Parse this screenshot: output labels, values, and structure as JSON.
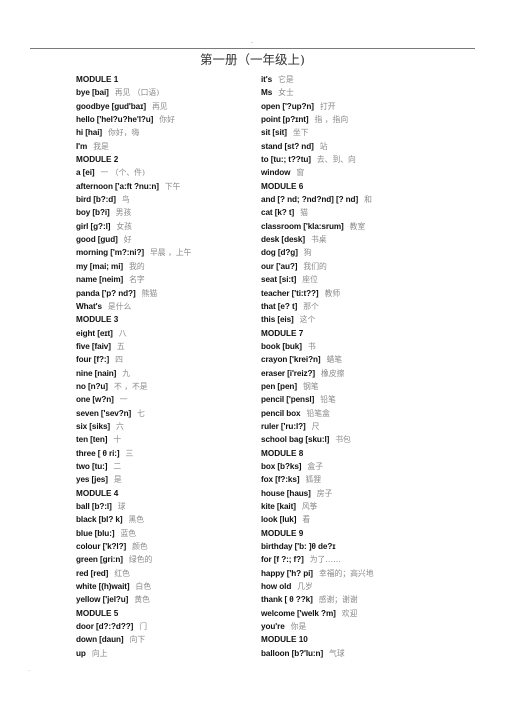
{
  "header": {
    "dot": "-",
    "title": "第一册（一年级上)"
  },
  "left_column": [
    {
      "type": "module",
      "text": "MODULE 1"
    },
    {
      "type": "entry",
      "word": "bye [bai]",
      "meaning": "再见  （口语)"
    },
    {
      "type": "entry",
      "word": "goodbye [ɡud'baɪ]",
      "meaning": "再见"
    },
    {
      "type": "entry",
      "word": "hello ['hel?u?he'l?u]",
      "meaning": "你好"
    },
    {
      "type": "entry",
      "word": "hi [hai]",
      "meaning": "你好，嗨"
    },
    {
      "type": "entry",
      "word": "I'm",
      "meaning": "我是"
    },
    {
      "type": "module",
      "text": "MODULE 2"
    },
    {
      "type": "entry",
      "word": "a [ei]",
      "meaning": "一  （个、件)"
    },
    {
      "type": "entry",
      "word": "afternoon ['a:ft ?nu:n]",
      "meaning": "下午"
    },
    {
      "type": "entry",
      "word": "bird [b?:d]",
      "meaning": "鸟"
    },
    {
      "type": "entry",
      "word": "boy [b?i]",
      "meaning": "男孩"
    },
    {
      "type": "entry",
      "word": "girl [g?:l]",
      "meaning": "女孩"
    },
    {
      "type": "entry",
      "word": "good [gud]",
      "meaning": "好"
    },
    {
      "type": "entry",
      "word": "morning ['m?:ni?]",
      "meaning": "早晨 ，上午"
    },
    {
      "type": "entry",
      "word": "my [mai; mi]",
      "meaning": "我的"
    },
    {
      "type": "entry",
      "word": "name [neim]",
      "meaning": "名字"
    },
    {
      "type": "entry",
      "word": "panda ['p? nd?]",
      "meaning": "熊猫"
    },
    {
      "type": "entry",
      "word": "What's",
      "meaning": "是什么"
    },
    {
      "type": "module",
      "text": "MODULE 3"
    },
    {
      "type": "entry",
      "word": "eight [eɪt]",
      "meaning": "八"
    },
    {
      "type": "entry",
      "word": "five [faiv]",
      "meaning": "五"
    },
    {
      "type": "entry",
      "word": "four [f?:]",
      "meaning": "四"
    },
    {
      "type": "entry",
      "word": "nine [nain]",
      "meaning": "九"
    },
    {
      "type": "entry",
      "word": "no [n?u]",
      "meaning": "不 ，不是"
    },
    {
      "type": "entry",
      "word": "one [w?n]",
      "meaning": "一"
    },
    {
      "type": "entry",
      "word": "seven ['sev?n]",
      "meaning": "七"
    },
    {
      "type": "entry",
      "word": "six [siks]",
      "meaning": "六"
    },
    {
      "type": "entry",
      "word": "ten [ten]",
      "meaning": "十"
    },
    {
      "type": "entry",
      "word": "three [ θ ri:]",
      "meaning": "三"
    },
    {
      "type": "entry",
      "word": "two [tu:]",
      "meaning": "二"
    },
    {
      "type": "entry",
      "word": "yes [jes]",
      "meaning": "是"
    },
    {
      "type": "module",
      "text": "MODULE   4"
    },
    {
      "type": "entry",
      "word": "ball [b?:l]",
      "meaning": "球"
    },
    {
      "type": "entry",
      "word": "black [bl? k]",
      "meaning": "黑色"
    },
    {
      "type": "entry",
      "word": "blue [blu:]",
      "meaning": "蓝色"
    },
    {
      "type": "entry",
      "word": "colour ['k?l?]",
      "meaning": "颜色"
    },
    {
      "type": "entry",
      "word": "green [gri:n]",
      "meaning": "绿色的"
    },
    {
      "type": "entry",
      "word": "red [red]",
      "meaning": "红色"
    },
    {
      "type": "entry",
      "word": "white [(h)wait]",
      "meaning": "白色"
    },
    {
      "type": "entry",
      "word": "yellow ['jel?u]",
      "meaning": "黄色"
    },
    {
      "type": "module",
      "text": "MODULE 5"
    },
    {
      "type": "entry",
      "word": "door [d?:?d??]",
      "meaning": "门"
    },
    {
      "type": "entry",
      "word": "down [daun]",
      "meaning": "向下"
    },
    {
      "type": "entry",
      "word": "up",
      "meaning": "向上"
    }
  ],
  "right_column": [
    {
      "type": "entry",
      "word": "it's",
      "meaning": "它是"
    },
    {
      "type": "entry",
      "word": "Ms",
      "meaning": "女士"
    },
    {
      "type": "entry",
      "word": "open ['?up?n]",
      "meaning": "打开"
    },
    {
      "type": "entry",
      "word": "point [p?ɪnt]",
      "meaning": "指 ，指向"
    },
    {
      "type": "entry",
      "word": "sit [sit]",
      "meaning": "坐下"
    },
    {
      "type": "entry",
      "word": "stand [st? nd]",
      "meaning": "站"
    },
    {
      "type": "entry",
      "word": "to [tu:; t??tu]",
      "meaning": "去、到、向"
    },
    {
      "type": "entry",
      "word": "window",
      "meaning": "窗"
    },
    {
      "type": "module",
      "text": "MODULE 6"
    },
    {
      "type": "entry",
      "word": "and [? nd; ?nd?nd] [? nd]",
      "meaning": "和"
    },
    {
      "type": "entry",
      "word": "cat [k? t]",
      "meaning": "猫"
    },
    {
      "type": "entry",
      "word": "classroom ['kla:srum]",
      "meaning": "教室"
    },
    {
      "type": "entry",
      "word": "desk [desk]",
      "meaning": "书桌"
    },
    {
      "type": "entry",
      "word": "dog [d?g]",
      "meaning": "狗"
    },
    {
      "type": "entry",
      "word": "our ['au?]",
      "meaning": "我们的"
    },
    {
      "type": "entry",
      "word": "seat [si:t]",
      "meaning": "座位"
    },
    {
      "type": "entry",
      "word": "teacher ['ti:t??]",
      "meaning": "教师"
    },
    {
      "type": "entry",
      "word": "that [e? t]",
      "meaning": "那个"
    },
    {
      "type": "entry",
      "word": "this [eis]",
      "meaning": "这个"
    },
    {
      "type": "module",
      "text": "MODULE 7"
    },
    {
      "type": "entry",
      "word": "book [buk]",
      "meaning": "书"
    },
    {
      "type": "entry",
      "word": "crayon ['krei?n]",
      "meaning": "蜡笔"
    },
    {
      "type": "entry",
      "word": "eraser [i'reiz?]",
      "meaning": "橡皮擦"
    },
    {
      "type": "entry",
      "word": "pen [pen]",
      "meaning": "钢笔"
    },
    {
      "type": "entry",
      "word": "pencil ['pensl]",
      "meaning": "铅笔"
    },
    {
      "type": "entry",
      "word": "pencil box",
      "meaning": "铅笔盒"
    },
    {
      "type": "entry",
      "word": "ruler ['ru:l?]",
      "meaning": "尺"
    },
    {
      "type": "entry",
      "word": "school   bag [sku:l]",
      "meaning": "书包"
    },
    {
      "type": "module",
      "text": "MODULE 8"
    },
    {
      "type": "entry",
      "word": "box [b?ks]",
      "meaning": "盒子"
    },
    {
      "type": "entry",
      "word": "fox [f?:ks]",
      "meaning": "狐狸"
    },
    {
      "type": "entry",
      "word": "house [haus]",
      "meaning": "房子"
    },
    {
      "type": "entry",
      "word": "kite [kait]",
      "meaning": "风筝"
    },
    {
      "type": "entry",
      "word": "look [luk]",
      "meaning": "看"
    },
    {
      "type": "module",
      "text": "MODULE 9"
    },
    {
      "type": "entry",
      "word": "birthday ['b:      ]θ de?ɪ",
      "meaning": ""
    },
    {
      "type": "entry",
      "word": "for [f ?:; f?]",
      "meaning": "为了……"
    },
    {
      "type": "entry",
      "word": "happy ['h? pi]",
      "meaning": "幸福的；高兴地"
    },
    {
      "type": "entry",
      "word": "how old",
      "meaning": "几岁"
    },
    {
      "type": "entry",
      "word": "thank [    θ ??k]",
      "meaning": "感谢；谢谢"
    },
    {
      "type": "entry",
      "word": "welcome ['welk ?m]",
      "meaning": "欢迎"
    },
    {
      "type": "entry",
      "word": "you're",
      "meaning": "你是"
    },
    {
      "type": "module",
      "text": "MODULE 10"
    },
    {
      "type": "entry",
      "word": "balloon [b?'lu:n]",
      "meaning": "气球"
    }
  ],
  "footer": {
    "dot": "-"
  }
}
